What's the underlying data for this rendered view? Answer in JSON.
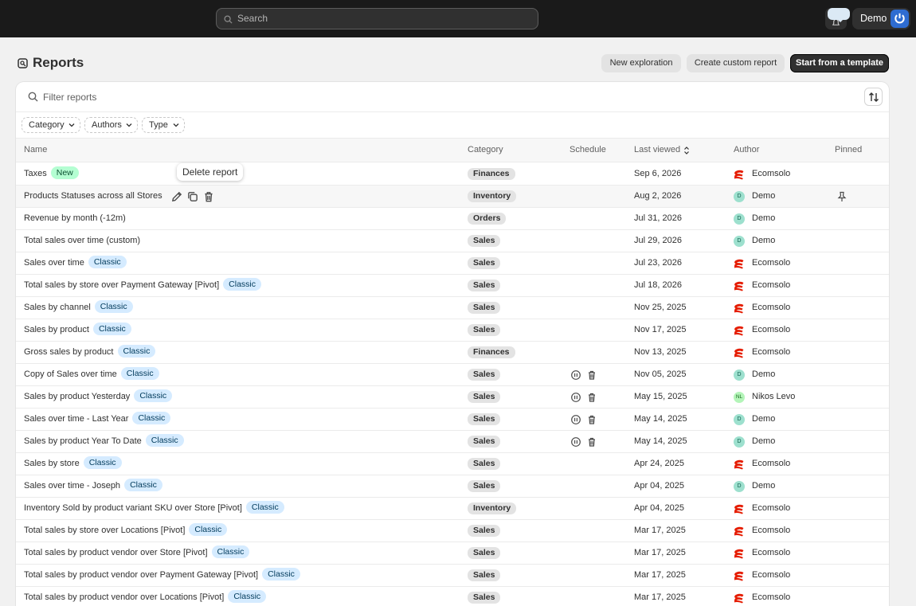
{
  "topbar": {
    "search_placeholder": "Search",
    "user_name": "Demo"
  },
  "page": {
    "title": "Reports",
    "buttons": {
      "new_exploration": "New exploration",
      "create_custom": "Create custom report",
      "start_template": "Start from a template"
    }
  },
  "filter": {
    "placeholder": "Filter reports",
    "chips": [
      "Category",
      "Authors",
      "Type"
    ]
  },
  "table": {
    "headers": {
      "name": "Name",
      "category": "Category",
      "schedule": "Schedule",
      "last_viewed": "Last viewed",
      "author": "Author",
      "pinned": "Pinned"
    },
    "tooltip": "Delete report",
    "rows": [
      {
        "name": "Taxes",
        "tag": "New",
        "tag_kind": "new",
        "category": "Finances",
        "scheduled": false,
        "date": "Sep 6, 2026",
        "author": "Ecomsolo",
        "author_kind": "brand",
        "pinned": false
      },
      {
        "name": "Products Statuses across all Stores",
        "tag": "",
        "tag_kind": "",
        "category": "Inventory",
        "scheduled": false,
        "date": "Aug 2, 2026",
        "author": "Demo",
        "author_kind": "D",
        "pinned": true,
        "hover": true
      },
      {
        "name": "Revenue by month (-12m)",
        "tag": "",
        "tag_kind": "",
        "category": "Orders",
        "scheduled": false,
        "date": "Jul 31, 2026",
        "author": "Demo",
        "author_kind": "D",
        "pinned": false
      },
      {
        "name": "Total sales over time (custom)",
        "tag": "",
        "tag_kind": "",
        "category": "Sales",
        "scheduled": false,
        "date": "Jul 29, 2026",
        "author": "Demo",
        "author_kind": "D",
        "pinned": false
      },
      {
        "name": "Sales over time",
        "tag": "Classic",
        "tag_kind": "classic",
        "category": "Sales",
        "scheduled": false,
        "date": "Jul 23, 2026",
        "author": "Ecomsolo",
        "author_kind": "brand",
        "pinned": false
      },
      {
        "name": "Total sales by store over Payment Gateway [Pivot]",
        "tag": "Classic",
        "tag_kind": "classic",
        "category": "Sales",
        "scheduled": false,
        "date": "Jul 18, 2026",
        "author": "Ecomsolo",
        "author_kind": "brand",
        "pinned": false
      },
      {
        "name": "Sales by channel",
        "tag": "Classic",
        "tag_kind": "classic",
        "category": "Sales",
        "scheduled": false,
        "date": "Nov 25, 2025",
        "author": "Ecomsolo",
        "author_kind": "brand",
        "pinned": false
      },
      {
        "name": "Sales by product",
        "tag": "Classic",
        "tag_kind": "classic",
        "category": "Sales",
        "scheduled": false,
        "date": "Nov 17, 2025",
        "author": "Ecomsolo",
        "author_kind": "brand",
        "pinned": false
      },
      {
        "name": "Gross sales by product",
        "tag": "Classic",
        "tag_kind": "classic",
        "category": "Finances",
        "scheduled": false,
        "date": "Nov 13, 2025",
        "author": "Ecomsolo",
        "author_kind": "brand",
        "pinned": false
      },
      {
        "name": "Copy of Sales over time",
        "tag": "Classic",
        "tag_kind": "classic",
        "category": "Sales",
        "scheduled": true,
        "date": "Nov 05, 2025",
        "author": "Demo",
        "author_kind": "D",
        "pinned": false
      },
      {
        "name": "Sales by product Yesterday",
        "tag": "Classic",
        "tag_kind": "classic",
        "category": "Sales",
        "scheduled": true,
        "date": "May 15, 2025",
        "author": "Nikos Levo",
        "author_kind": "NL",
        "pinned": false
      },
      {
        "name": "Sales over time - Last Year",
        "tag": "Classic",
        "tag_kind": "classic",
        "category": "Sales",
        "scheduled": true,
        "date": "May 14, 2025",
        "author": "Demo",
        "author_kind": "D",
        "pinned": false
      },
      {
        "name": "Sales by product Year To Date",
        "tag": "Classic",
        "tag_kind": "classic",
        "category": "Sales",
        "scheduled": true,
        "date": "May 14, 2025",
        "author": "Demo",
        "author_kind": "D",
        "pinned": false
      },
      {
        "name": "Sales by store",
        "tag": "Classic",
        "tag_kind": "classic",
        "category": "Sales",
        "scheduled": false,
        "date": "Apr 24, 2025",
        "author": "Ecomsolo",
        "author_kind": "brand",
        "pinned": false
      },
      {
        "name": "Sales over time - Joseph",
        "tag": "Classic",
        "tag_kind": "classic",
        "category": "Sales",
        "scheduled": false,
        "date": "Apr 04, 2025",
        "author": "Demo",
        "author_kind": "D",
        "pinned": false
      },
      {
        "name": "Inventory Sold by product variant SKU over Store [Pivot]",
        "tag": "Classic",
        "tag_kind": "classic",
        "category": "Inventory",
        "scheduled": false,
        "date": "Apr 04, 2025",
        "author": "Ecomsolo",
        "author_kind": "brand",
        "pinned": false
      },
      {
        "name": "Total sales by store over Locations [Pivot]",
        "tag": "Classic",
        "tag_kind": "classic",
        "category": "Sales",
        "scheduled": false,
        "date": "Mar 17, 2025",
        "author": "Ecomsolo",
        "author_kind": "brand",
        "pinned": false
      },
      {
        "name": "Total sales by product vendor over Store [Pivot]",
        "tag": "Classic",
        "tag_kind": "classic",
        "category": "Sales",
        "scheduled": false,
        "date": "Mar 17, 2025",
        "author": "Ecomsolo",
        "author_kind": "brand",
        "pinned": false
      },
      {
        "name": "Total sales by product vendor over Payment Gateway [Pivot]",
        "tag": "Classic",
        "tag_kind": "classic",
        "category": "Sales",
        "scheduled": false,
        "date": "Mar 17, 2025",
        "author": "Ecomsolo",
        "author_kind": "brand",
        "pinned": false
      },
      {
        "name": "Total sales by product vendor over Locations [Pivot]",
        "tag": "Classic",
        "tag_kind": "classic",
        "category": "Sales",
        "scheduled": false,
        "date": "Mar 17, 2025",
        "author": "Ecomsolo",
        "author_kind": "brand",
        "pinned": false
      }
    ]
  },
  "colors": {
    "topbar": "#1a1a1a",
    "classic_tag": "#d5ebff",
    "new_tag": "#b4fed2",
    "brand_author": "#e51c00"
  },
  "icons": {
    "search": "search-icon",
    "notifications": "bell-icon",
    "reports": "reports-icon",
    "sort": "sort-icon",
    "edit": "pencil-icon",
    "duplicate": "duplicate-icon",
    "delete": "trash-icon",
    "pause": "pause-icon",
    "pin": "pin-icon"
  }
}
